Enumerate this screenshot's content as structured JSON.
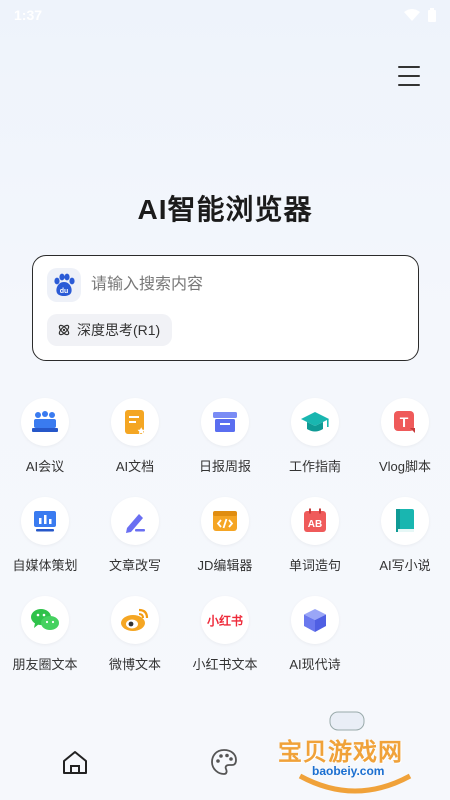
{
  "status_bar": {
    "time": "1:37"
  },
  "app": {
    "title": "AI智能浏览器"
  },
  "search": {
    "placeholder": "请输入搜索内容",
    "engine_icon": "baidu-paw-icon",
    "engine_text": "du",
    "deep_think_label": "深度思考(R1)"
  },
  "tools": [
    {
      "label": "AI会议",
      "icon": "meeting-icon"
    },
    {
      "label": "AI文档",
      "icon": "document-icon"
    },
    {
      "label": "日报周报",
      "icon": "report-icon"
    },
    {
      "label": "工作指南",
      "icon": "graduation-cap-icon"
    },
    {
      "label": "Vlog脚本",
      "icon": "vlog-t-icon"
    },
    {
      "label": "自媒体策划",
      "icon": "bar-chart-icon"
    },
    {
      "label": "文章改写",
      "icon": "pen-icon"
    },
    {
      "label": "JD编辑器",
      "icon": "code-icon"
    },
    {
      "label": "单词造句",
      "icon": "ab-calendar-icon"
    },
    {
      "label": "AI写小说",
      "icon": "book-icon"
    },
    {
      "label": "朋友圈文本",
      "icon": "wechat-icon"
    },
    {
      "label": "微博文本",
      "icon": "weibo-icon"
    },
    {
      "label": "小红书文本",
      "icon": "xiaohongshu-icon"
    },
    {
      "label": "AI现代诗",
      "icon": "cube-icon"
    }
  ],
  "xiaohongshu_logo_text": "小红书",
  "ab_icon_text": "AB",
  "vlog_icon_text": "T",
  "bottom_nav": [
    {
      "name": "home",
      "icon": "home-icon"
    },
    {
      "name": "palette",
      "icon": "palette-icon"
    }
  ],
  "watermark": {
    "title": "宝贝游戏网",
    "url": "baobeiy.com"
  }
}
